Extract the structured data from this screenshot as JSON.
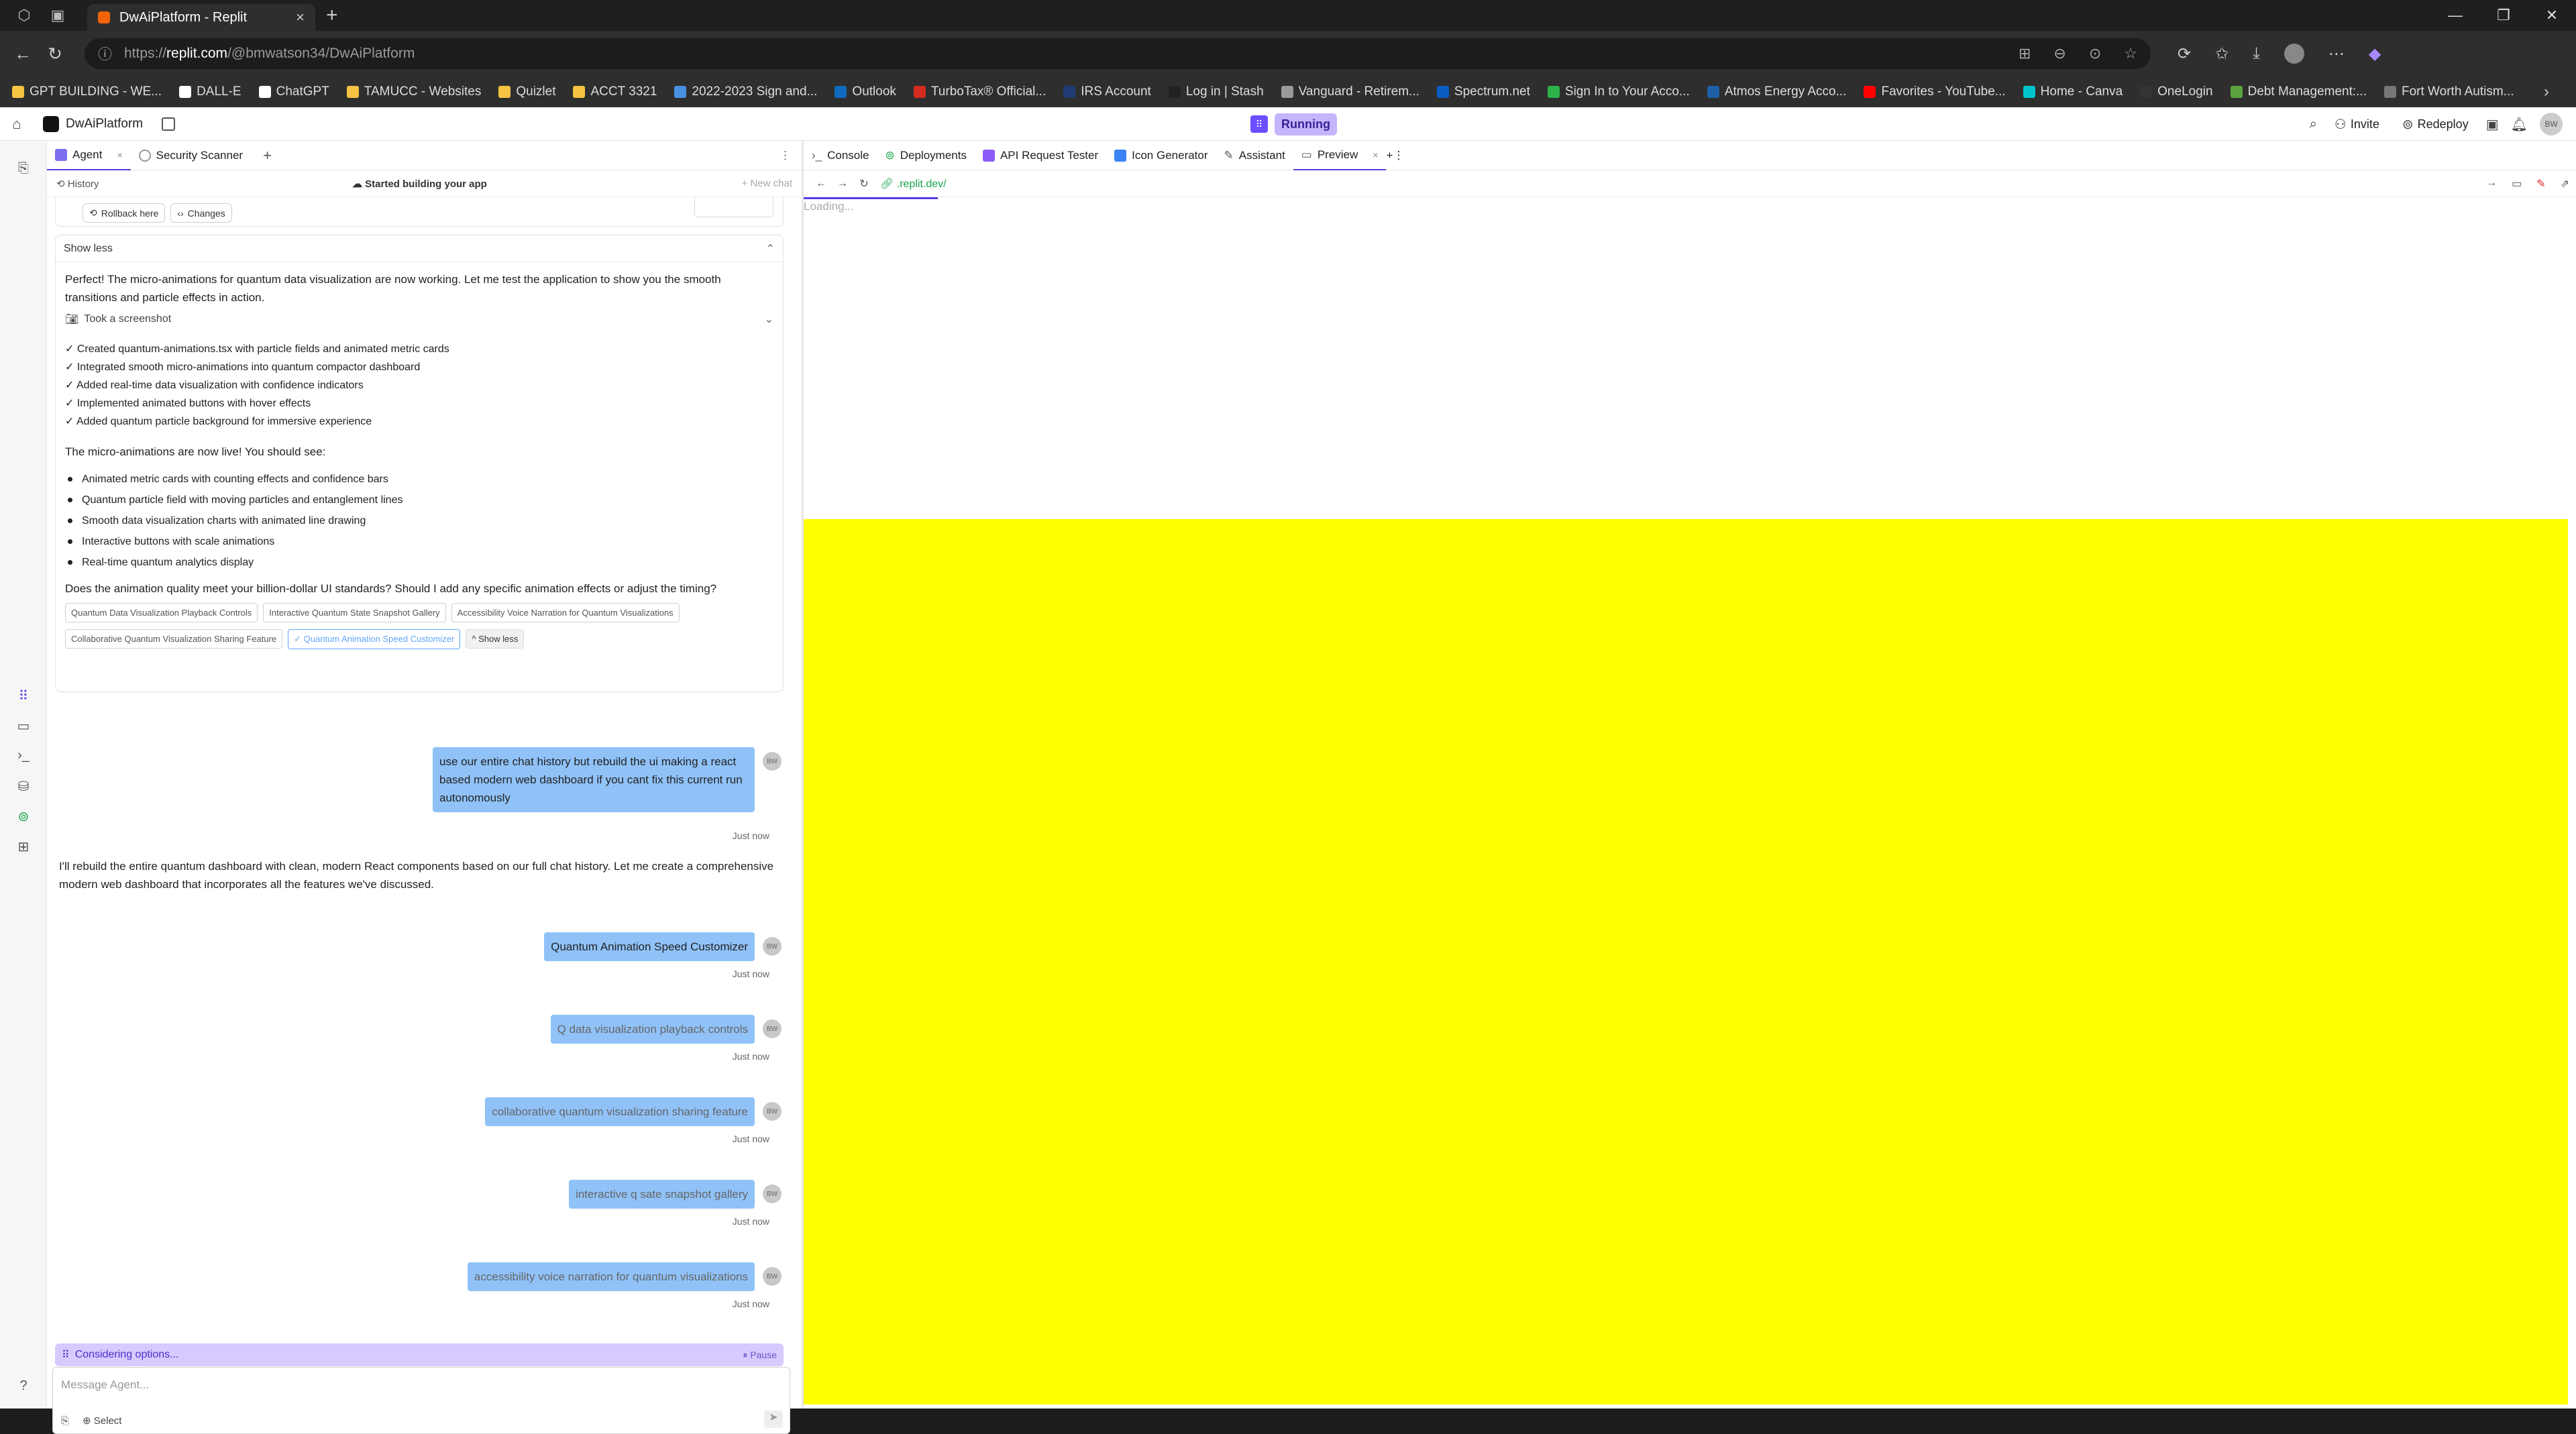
{
  "browser": {
    "tab_title": "DwAiPlatform - Replit",
    "url_prefix": "https://",
    "url_host": "replit.com",
    "url_path": "/@bmwatson34/DwAiPlatform"
  },
  "bookmarks": [
    {
      "label": "GPT BUILDING - WE...",
      "color": "#f6c342"
    },
    {
      "label": "DALL-E",
      "color": "#ffffff"
    },
    {
      "label": "ChatGPT",
      "color": "#ffffff"
    },
    {
      "label": "TAMUCC - Websites",
      "color": "#f6c342"
    },
    {
      "label": "Quizlet",
      "color": "#f6c342"
    },
    {
      "label": "ACCT 3321",
      "color": "#f6c342"
    },
    {
      "label": "2022-2023 Sign and...",
      "color": "#4a90e2"
    },
    {
      "label": "Outlook",
      "color": "#0f6cbd"
    },
    {
      "label": "TurboTax® Official...",
      "color": "#d52b1e"
    },
    {
      "label": "IRS Account",
      "color": "#1f3b73"
    },
    {
      "label": "Log in | Stash",
      "color": "#222"
    },
    {
      "label": "Vanguard - Retirem...",
      "color": "#999"
    },
    {
      "label": "Spectrum.net",
      "color": "#0a5dc2"
    },
    {
      "label": "Sign In to Your Acco...",
      "color": "#2db24a"
    },
    {
      "label": "Atmos Energy Acco...",
      "color": "#1f5fa8"
    },
    {
      "label": "Favorites - YouTube...",
      "color": "#ff0000"
    },
    {
      "label": "Home - Canva",
      "color": "#00c4cc"
    },
    {
      "label": "OneLogin",
      "color": "#333"
    },
    {
      "label": "Debt Management:...",
      "color": "#5aa33e"
    },
    {
      "label": "Fort Worth Autism...",
      "color": "#777"
    }
  ],
  "header": {
    "project_name": "DwAiPlatform",
    "status": "Running",
    "invite": "Invite",
    "redeploy": "Redeploy",
    "avatar": "BW"
  },
  "left_tabs": [
    {
      "label": "Agent",
      "close": "×"
    },
    {
      "label": "Security Scanner"
    }
  ],
  "history_bar": {
    "history": "History",
    "started": "Started building your app",
    "new_chat": "+ New chat"
  },
  "chat": {
    "rollback": "Rollback here",
    "changes": "Changes",
    "show_less": "Show less",
    "intro": "Perfect! The micro-animations for quantum data visualization are now working. Let me test the application to show you the smooth transitions and particle effects in action.",
    "screenshot": "Took a screenshot",
    "checks": [
      "✓ Created quantum-animations.tsx with particle fields and animated metric cards",
      "✓ Integrated smooth micro-animations into quantum compactor dashboard",
      "✓ Added real-time data visualization with confidence indicators",
      "✓ Implemented animated buttons with hover effects",
      "✓ Added quantum particle background for immersive experience"
    ],
    "live_line": "The micro-animations are now live! You should see:",
    "bullets": [
      "Animated metric cards with counting effects and confidence bars",
      "Quantum particle field with moving particles and entanglement lines",
      "Smooth data visualization charts with animated line drawing",
      "Interactive buttons with scale animations",
      "Real-time quantum analytics display"
    ],
    "question": "Does the animation quality meet your billion-dollar UI standards? Should I add any specific animation effects or adjust the timing?",
    "suggestions_row1": [
      "Quantum Data Visualization Playback Controls",
      "Interactive Quantum State Snapshot Gallery",
      "Accessibility Voice Narration for Quantum Visualizations"
    ],
    "suggestions_row2": [
      "Collaborative Quantum Visualization Sharing Feature",
      "✓ Quantum Animation Speed Customizer"
    ],
    "suggest_show_less": "^ Show less",
    "user_msg_1": "use our entire chat history but rebuild the ui making a react based modern web dashboard if you cant fix this current run autonomously",
    "agent_reply": "I'll rebuild the entire quantum dashboard with clean, modern React components based on our full chat history. Let me create a comprehensive modern web dashboard that incorporates all the features we've discussed.",
    "user_msgs": [
      "Quantum Animation Speed Customizer",
      "Q data visualization playback controls",
      "collaborative quantum visualization sharing feature",
      "interactive q sate snapshot gallery",
      "accessibility voice narration for quantum visualizations"
    ],
    "just_now": "Just now",
    "user_avatar": "BW"
  },
  "status_bar": {
    "considering": "Considering options...",
    "pause": "⏸ Pause"
  },
  "input": {
    "placeholder": "Message Agent...",
    "select": "Select"
  },
  "right_tabs": [
    {
      "label": "Console"
    },
    {
      "label": "Deployments"
    },
    {
      "label": "API Request Tester"
    },
    {
      "label": "Icon Generator"
    },
    {
      "label": "Assistant"
    },
    {
      "label": "Preview",
      "close": "×"
    }
  ],
  "preview": {
    "url": ".replit.dev/",
    "loading": "Loading...",
    "fill_color": "#ffff00"
  }
}
